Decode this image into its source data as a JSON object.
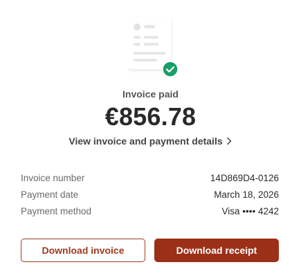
{
  "status": {
    "label": "Invoice paid",
    "color": "#1a9e6a"
  },
  "amount": "€856.78",
  "details_link": "View invoice and payment details",
  "details": [
    {
      "label": "Invoice number",
      "value": "14D869D4-0126"
    },
    {
      "label": "Payment date",
      "value": "March 18, 2026"
    },
    {
      "label": "Payment method",
      "value": "Visa •••• 4242"
    }
  ],
  "buttons": {
    "download_invoice": "Download invoice",
    "download_receipt": "Download receipt"
  },
  "colors": {
    "accent": "#9b2f17",
    "success": "#1a9e6a"
  },
  "icons": {
    "document": "invoice-document-icon",
    "check": "check-circle-icon",
    "chevron": "chevron-right-icon"
  }
}
